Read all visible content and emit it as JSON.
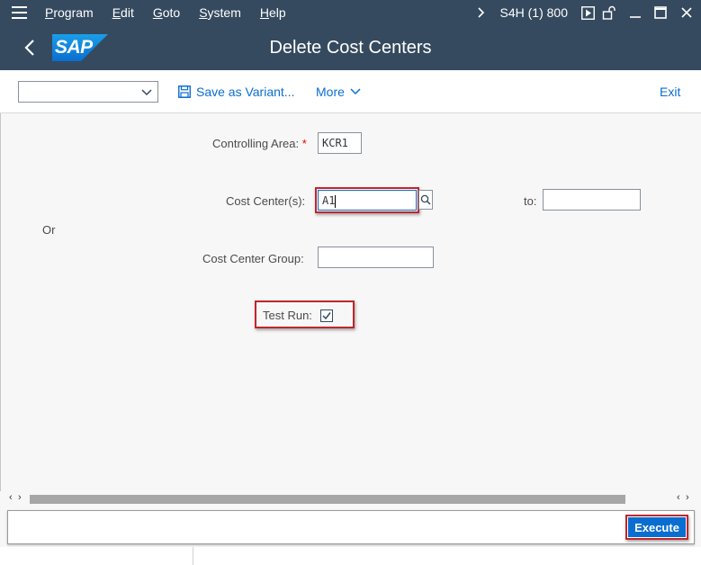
{
  "menu": {
    "items": [
      {
        "key": "P",
        "rest": "rogram"
      },
      {
        "key": "E",
        "rest": "dit"
      },
      {
        "key": "G",
        "rest": "oto"
      },
      {
        "key": "S",
        "rest": "ystem"
      },
      {
        "key": "H",
        "rest": "elp"
      }
    ],
    "system_info": "S4H (1) 800",
    "icons": [
      "hamburger-icon",
      "chevron-right-icon",
      "play-icon",
      "unlock-icon",
      "minimize-icon",
      "maximize-icon",
      "close-icon"
    ]
  },
  "header": {
    "logo_text": "SAP",
    "title": "Delete Cost Centers",
    "brand_color": "#354a5f",
    "logo_color": "#0a6ed1"
  },
  "toolbar": {
    "variant_value": "",
    "save_variant_label": "Save as Variant...",
    "more_label": "More",
    "exit_label": "Exit",
    "accent": "#0a6ed1"
  },
  "form": {
    "controlling_area": {
      "label": "Controlling Area:",
      "required_mark": "*",
      "value": "KCR1"
    },
    "cost_centers": {
      "label": "Cost Center(s):",
      "value": "A1",
      "to_label": "to:",
      "to_value": ""
    },
    "or_label": "Or",
    "cost_center_group": {
      "label": "Cost Center Group:",
      "value": ""
    },
    "test_run": {
      "label": "Test Run:",
      "checked": true
    }
  },
  "footer": {
    "execute_label": "Execute"
  },
  "highlight_color": "#c0262c"
}
